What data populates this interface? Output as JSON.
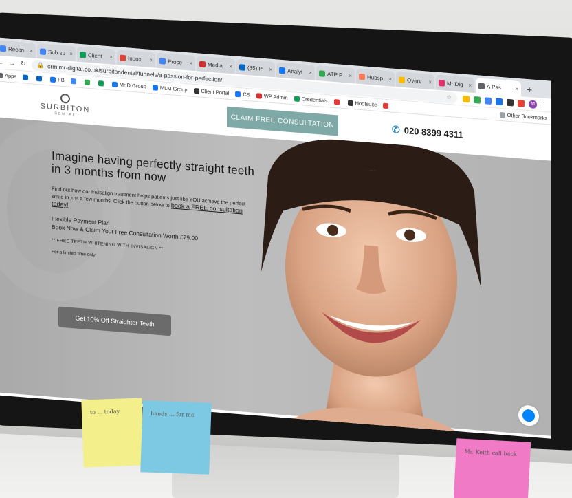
{
  "browser": {
    "tabs": [
      {
        "label": "Recen",
        "color": "#4285f4"
      },
      {
        "label": "Sub su",
        "color": "#4285f4"
      },
      {
        "label": "Client",
        "color": "#0f9d58"
      },
      {
        "label": "Inbox",
        "color": "#db4437"
      },
      {
        "label": "Proce",
        "color": "#4285f4"
      },
      {
        "label": "Media",
        "color": "#d32f2f"
      },
      {
        "label": "(35) P",
        "color": "#0a66c2"
      },
      {
        "label": "Analyt",
        "color": "#1877f2"
      },
      {
        "label": "ATP P",
        "color": "#34a853"
      },
      {
        "label": "Hubsp",
        "color": "#ff7a59"
      },
      {
        "label": "Overv",
        "color": "#fbbc04"
      },
      {
        "label": "Mr Dig",
        "color": "#e1306c"
      },
      {
        "label": "A Pas",
        "color": "#5f6368",
        "active": true
      }
    ],
    "new_tab": "+",
    "url": "crm.mr-digital.co.uk/surbitondental/funnels/a-passion-for-perfection/",
    "avatar": "M",
    "bookmarks": [
      {
        "label": "Apps",
        "color": "#5f6368"
      },
      {
        "label": "",
        "color": "#0a66c2"
      },
      {
        "label": "",
        "color": "#0a66c2"
      },
      {
        "label": "FB",
        "color": "#1877f2"
      },
      {
        "label": "",
        "color": "#4285f4"
      },
      {
        "label": "",
        "color": "#34a853"
      },
      {
        "label": "",
        "color": "#0f9d58"
      },
      {
        "label": "Mr D Group",
        "color": "#1877f2"
      },
      {
        "label": "MLM Group",
        "color": "#1877f2"
      },
      {
        "label": "Client Portal",
        "color": "#333333"
      },
      {
        "label": "CS",
        "color": "#1877f2"
      },
      {
        "label": "WP Admin",
        "color": "#d32f2f"
      },
      {
        "label": "Credentials",
        "color": "#0f9d58"
      },
      {
        "label": "",
        "color": "#e53935"
      },
      {
        "label": "Hootsuite",
        "color": "#333333"
      },
      {
        "label": "",
        "color": "#e53935"
      }
    ],
    "other_bookmarks": "Other Bookmarks"
  },
  "site": {
    "logo_name": "SURBITON",
    "logo_sub": "DENTAL",
    "claim_button": "CLAIM FREE CONSULTATION",
    "phone": "020 8399 4311",
    "accent": "#7fa9a7"
  },
  "hero": {
    "headline": "Imagine having perfectly straight teeth in 3 months from now",
    "body": "Find out how our Invisalign treatment helps patients just like YOU achieve the perfect smile in just a few months. Click the button below to",
    "link": "book a FREE consultation today!",
    "plan_line1": "Flexible Payment Plan",
    "plan_line2": "Book Now & Claim Your Free Consultation Worth £79.00",
    "whitening": "** FREE TEETH WHITENING WITH INVISALIGN **",
    "limited": "For a limited time only!",
    "cta": "Get 10% Off Straighter Teeth"
  },
  "notes": {
    "yellow": "to ... today",
    "blue": "hands ... for me",
    "pink": "Mr. Keith call back"
  }
}
